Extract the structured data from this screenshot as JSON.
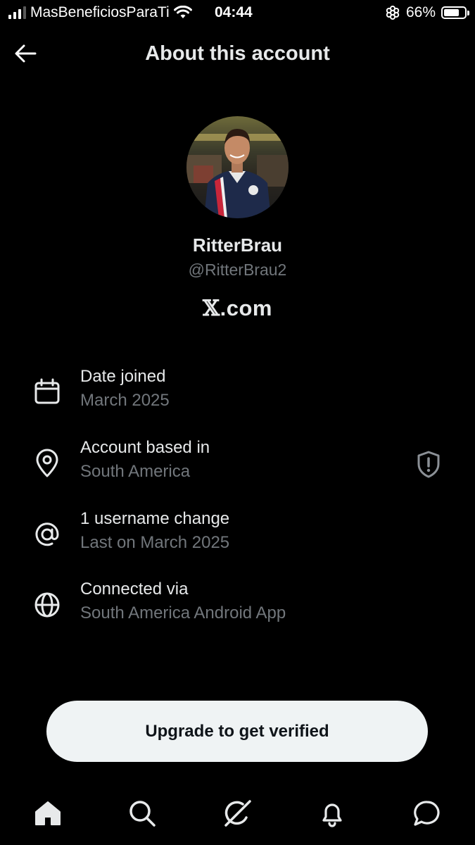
{
  "status_bar": {
    "carrier": "MasBeneficiosParaTi",
    "time": "04:44",
    "battery": "66%",
    "battery_level": 0.66,
    "icons": [
      "cellular-signal-icon",
      "wifi-icon",
      "focus-mode-icon",
      "battery-icon"
    ]
  },
  "header": {
    "title": "About this account",
    "back_icon": "arrow-left-icon"
  },
  "profile": {
    "display_name": "RitterBrau",
    "handle": "@RitterBrau2",
    "site_x": "𝕏",
    "site_rest": ".com"
  },
  "info": [
    {
      "icon": "calendar-icon",
      "label": "Date joined",
      "value": "March 2025"
    },
    {
      "icon": "location-pin-icon",
      "label": "Account based in",
      "value": "South America",
      "trailing_icon": "shield-alert-icon"
    },
    {
      "icon": "at-sign-icon",
      "label": "1 username change",
      "value": "Last on March 2025"
    },
    {
      "icon": "globe-icon",
      "label": "Connected via",
      "value": "South America Android App"
    }
  ],
  "verify_button": {
    "label": "Upgrade to get verified"
  },
  "tab_bar": {
    "tabs": [
      "home-icon",
      "search-icon",
      "grok-icon",
      "notifications-icon",
      "messages-icon"
    ]
  },
  "colors": {
    "background": "#000000",
    "primary_text": "#e7e9ea",
    "secondary_text": "#71767b",
    "button_bg": "#eff3f4"
  }
}
